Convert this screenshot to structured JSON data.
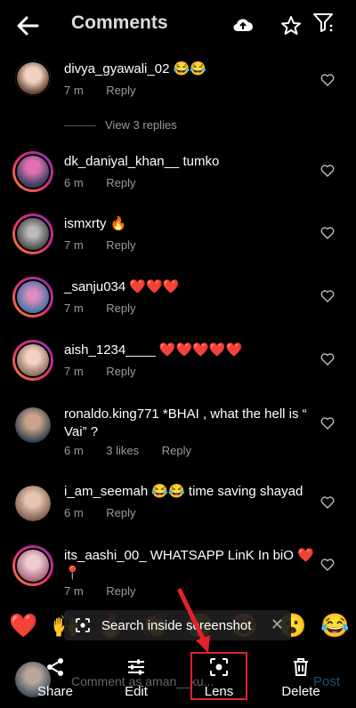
{
  "header": {
    "title": "Comments"
  },
  "view_replies": "View 3 replies",
  "comments": [
    {
      "user": "divya_gyawali_02",
      "text": " 😂😂",
      "time": "7 m",
      "reply": "Reply"
    },
    {
      "user": "dk_daniyal_khan__",
      "text": " tumko",
      "time": "6 m",
      "reply": "Reply"
    },
    {
      "user": "ismxrty",
      "text": " 🔥",
      "time": "7 m",
      "reply": "Reply"
    },
    {
      "user": "_sanju034",
      "text": " ❤️❤️❤️",
      "time": "7 m",
      "reply": "Reply"
    },
    {
      "user": "aish_1234____",
      "text": " ❤️❤️❤️❤️❤️",
      "time": "7 m",
      "reply": "Reply"
    },
    {
      "user": "ronaldo.king771",
      "text": " *BHAI , what the hell is “ Vai” ?",
      "time": "6 m",
      "likes": "3 likes",
      "reply": "Reply"
    },
    {
      "user": "i_am_seemah",
      "text": " 😂😂 time saving shayad",
      "time": "6 m",
      "reply": "Reply"
    },
    {
      "user": "its_aashi_00_",
      "text": " WHATSAPP LinK In biO ❤️📍",
      "time": "7 m",
      "reply": "Reply"
    }
  ],
  "emojis": [
    "❤️",
    "🙌",
    "🔥",
    "👏",
    "😢",
    "😍",
    "😮",
    "😂"
  ],
  "lens_toast": {
    "text": "Search inside screenshot"
  },
  "composer": {
    "placeholder": "Comment as aman__ku...",
    "post": "Post"
  },
  "tools": {
    "share": "Share",
    "edit": "Edit",
    "lens": "Lens",
    "delete": "Delete"
  }
}
